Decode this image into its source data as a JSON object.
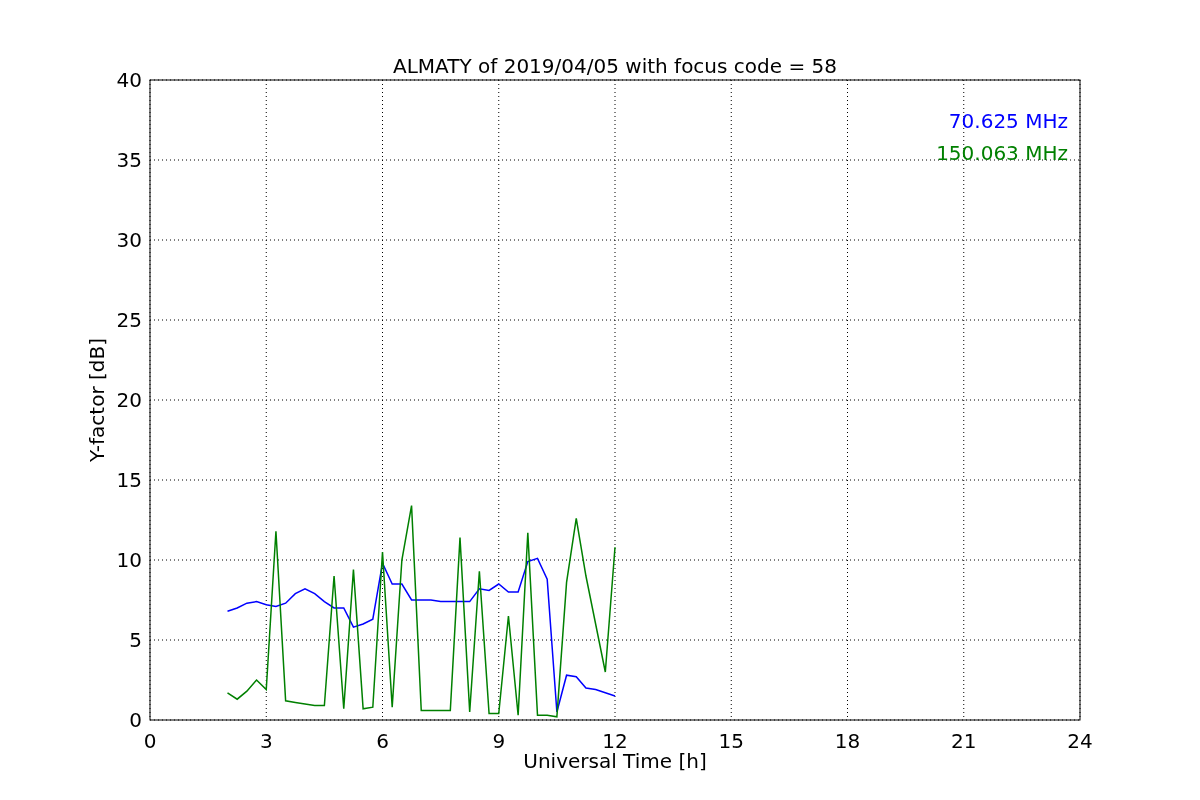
{
  "chart_data": {
    "type": "line",
    "title": "ALMATY of 2019/04/05 with focus code = 58",
    "xlabel": "Universal Time [h]",
    "ylabel": "Y-factor [dB]",
    "x": [
      2,
      2.25,
      2.5,
      2.75,
      3,
      3.25,
      3.5,
      3.75,
      4,
      4.25,
      4.5,
      4.75,
      5,
      5.25,
      5.5,
      5.75,
      6,
      6.25,
      6.5,
      6.75,
      7,
      7.25,
      7.5,
      7.75,
      8,
      8.25,
      8.5,
      8.75,
      9,
      9.25,
      9.5,
      9.75,
      10,
      10.25,
      10.5,
      10.75,
      11,
      11.25,
      11.5,
      11.75,
      12
    ],
    "series": [
      {
        "name": "70.625 MHz",
        "color": "#0000ff",
        "values": [
          6.8,
          7.0,
          7.3,
          7.4,
          7.2,
          7.1,
          7.3,
          7.9,
          8.2,
          7.9,
          7.4,
          7.0,
          7.0,
          5.8,
          6.0,
          6.3,
          9.8,
          8.5,
          8.5,
          7.5,
          7.5,
          7.5,
          7.4,
          7.4,
          7.4,
          7.4,
          8.2,
          8.1,
          8.5,
          8.0,
          8.0,
          9.9,
          10.1,
          8.8,
          0.5,
          2.8,
          2.7,
          2.0,
          1.9,
          1.7,
          1.5
        ]
      },
      {
        "name": "150.063 MHz",
        "color": "#008000",
        "values": [
          1.7,
          1.3,
          1.8,
          2.5,
          1.9,
          11.8,
          1.2,
          1.1,
          1.0,
          0.9,
          0.9,
          9.0,
          0.7,
          9.4,
          0.7,
          0.8,
          10.5,
          0.8,
          10.0,
          13.4,
          0.6,
          0.6,
          0.6,
          0.6,
          11.4,
          0.5,
          9.3,
          0.4,
          0.4,
          6.5,
          0.3,
          11.7,
          0.3,
          0.3,
          0.2,
          8.6,
          12.6,
          9.0,
          6.0,
          3.0,
          10.8
        ]
      }
    ],
    "xlim": [
      0,
      24
    ],
    "ylim": [
      0,
      40
    ],
    "xticks": [
      0,
      3,
      6,
      9,
      12,
      15,
      18,
      21,
      24
    ],
    "yticks": [
      0,
      5,
      10,
      15,
      20,
      25,
      30,
      35,
      40
    ],
    "grid": true
  }
}
